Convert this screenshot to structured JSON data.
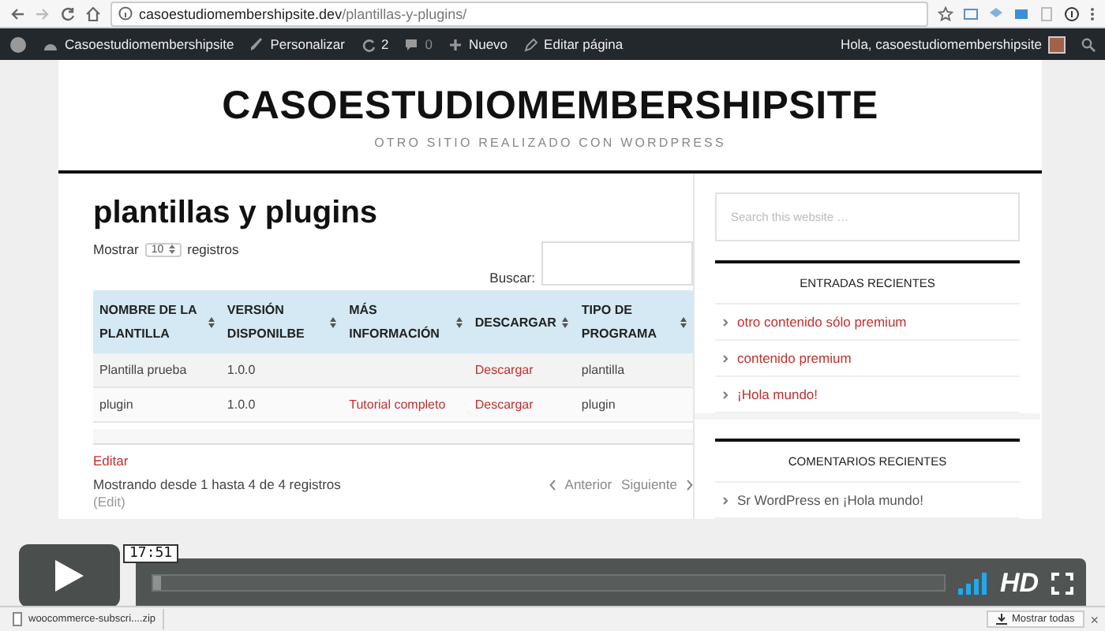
{
  "browser": {
    "url_host": "casoestudiomembershipsite.dev",
    "url_path": "/plantillas-y-plugins/"
  },
  "admin_bar": {
    "site": "Casoestudiomembershipsite",
    "customize": "Personalizar",
    "updates": "2",
    "comments": "0",
    "new": "Nuevo",
    "edit": "Editar página",
    "greeting": "Hola, casoestudiomembershipsite"
  },
  "site": {
    "title": "CASOESTUDIOMEMBERSHIPSITE",
    "tagline": "OTRO SITIO REALIZADO CON WORDPRESS"
  },
  "page": {
    "title": "plantillas y plugins",
    "show_label": "Mostrar",
    "show_value": "10",
    "show_suffix": "registros",
    "search_label": "Buscar:",
    "table": {
      "columns": [
        "NOMBRE DE LA PLANTILLA",
        "VERSIÓN DISPONILBE",
        "MÁS INFORMACIÓN",
        "DESCARGAR",
        "TIPO DE PROGRAMA"
      ],
      "rows": [
        {
          "cells": [
            {
              "text": "Plantilla prueba",
              "link": false
            },
            {
              "text": "1.0.0",
              "link": false
            },
            null,
            {
              "text": "Descargar",
              "link": true
            },
            {
              "text": "plantilla",
              "link": false
            }
          ]
        },
        {
          "cells": [
            {
              "text": "plugin",
              "link": false
            },
            {
              "text": "1.0.0",
              "link": false
            },
            {
              "text": "Tutorial completo",
              "link": true
            },
            {
              "text": "Descargar",
              "link": true
            },
            {
              "text": "plugin",
              "link": false
            }
          ]
        }
      ]
    },
    "edit_link": "Editar",
    "info": "Mostrando desde 1 hasta 4 de 4 registros",
    "prev": "Anterior",
    "next": "Siguiente",
    "edit_link_2": "(Edit)"
  },
  "sidebar": {
    "search_placeholder": "Search this website …",
    "widgets": [
      {
        "title": "ENTRADAS RECIENTES",
        "items": [
          "otro contenido sólo premium",
          "contenido premium",
          "¡Hola mundo!"
        ],
        "link_items": true
      },
      {
        "title": "COMENTARIOS RECIENTES",
        "items": [
          "Sr WordPress en ¡Hola mundo!"
        ],
        "link_items": false
      }
    ]
  },
  "video_player": {
    "time": "17:51",
    "hd_label": "HD",
    "level": 0.01
  },
  "downloads_bar": {
    "file": "woocommerce-subscri....zip",
    "show_all": "Mostrar todas",
    "close": "×"
  }
}
